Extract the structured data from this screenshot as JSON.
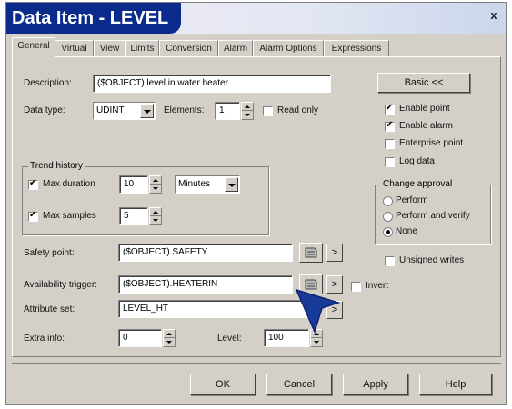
{
  "window": {
    "title": "Data Item - LEVEL",
    "close_label": "x"
  },
  "tabs": [
    {
      "label": "General"
    },
    {
      "label": "Virtual"
    },
    {
      "label": "View"
    },
    {
      "label": "Limits"
    },
    {
      "label": "Conversion"
    },
    {
      "label": "Alarm"
    },
    {
      "label": "Alarm Options"
    },
    {
      "label": "Expressions"
    }
  ],
  "general": {
    "description_label": "Description:",
    "description_value": "($OBJECT) level in water heater",
    "data_type_label": "Data type:",
    "data_type_value": "UDINT",
    "elements_label": "Elements:",
    "elements_value": "1",
    "read_only_label": "Read only",
    "read_only_checked": false,
    "basic_button": "Basic <<",
    "enable_point_label": "Enable point",
    "enable_point_checked": true,
    "enable_alarm_label": "Enable alarm",
    "enable_alarm_checked": true,
    "enterprise_point_label": "Enterprise point",
    "enterprise_point_checked": false,
    "log_data_label": "Log data",
    "log_data_checked": false,
    "trend": {
      "group_label": "Trend history",
      "max_duration_label": "Max duration",
      "max_duration_checked": true,
      "max_duration_value": "10",
      "duration_unit": "Minutes",
      "max_samples_label": "Max samples",
      "max_samples_checked": true,
      "max_samples_value": "5"
    },
    "change_approval": {
      "group_label": "Change approval",
      "options": [
        "Perform",
        "Perform and verify",
        "None"
      ],
      "selected": "None"
    },
    "unsigned_writes_label": "Unsigned writes",
    "unsigned_writes_checked": false,
    "safety_point_label": "Safety point:",
    "safety_point_value": "($OBJECT).SAFETY",
    "availability_trigger_label": "Availability trigger:",
    "availability_trigger_value": "($OBJECT).HEATERIN",
    "invert_label": "Invert",
    "invert_checked": false,
    "attribute_set_label": "Attribute set:",
    "attribute_set_value": "LEVEL_HT",
    "extra_info_label": "Extra info:",
    "extra_info_value": "0",
    "level_label": "Level:",
    "level_value": "100",
    "arrow_glyph": ">"
  },
  "footer": {
    "ok": "OK",
    "cancel": "Cancel",
    "apply": "Apply",
    "help": "Help"
  },
  "icons": [
    "close-icon",
    "browse-icon",
    "spin-icon",
    "dropdown-arrow-icon",
    "cursor-arrow-icon"
  ],
  "colors": {
    "title_bg": "#0a2a8c",
    "title_text": "#ffffff",
    "dialog_bg": "#d4d0c8",
    "cursor": "#1a3a9a"
  }
}
